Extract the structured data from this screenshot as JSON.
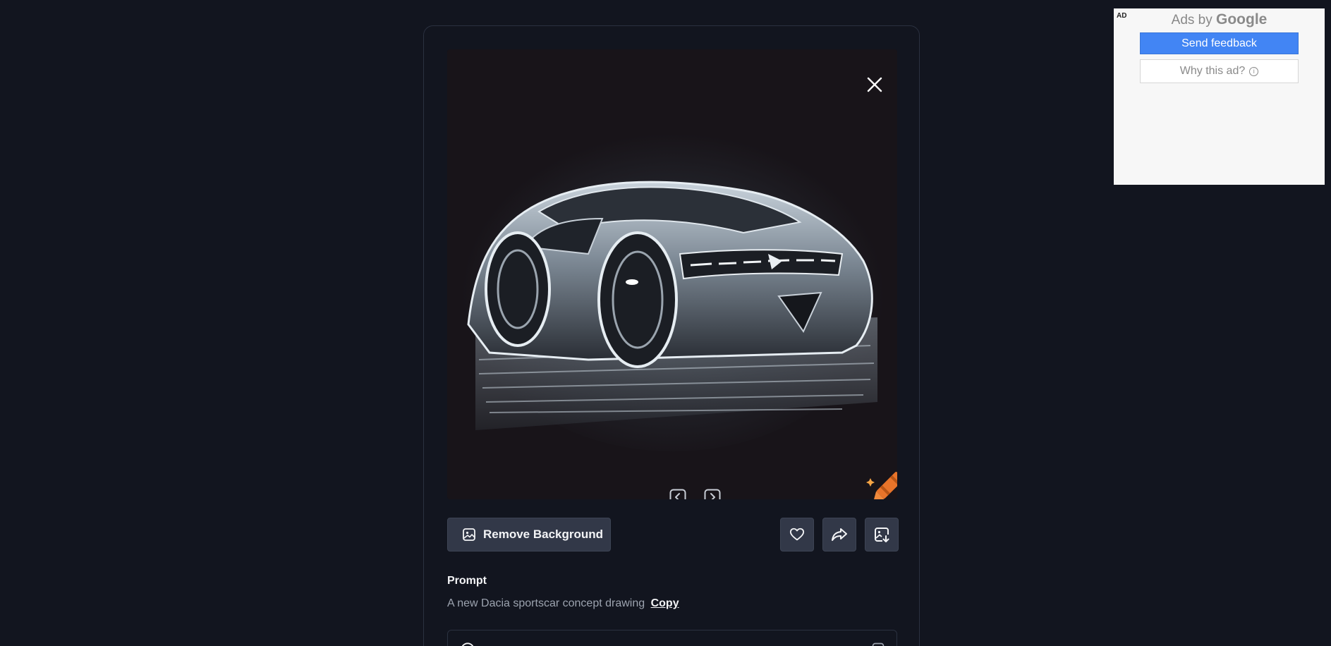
{
  "modal": {
    "image": {
      "alt_subject": "sportscar concept drawing",
      "close_icon": "close-icon",
      "prev_icon": "chevron-left-icon",
      "next_icon": "chevron-right-icon",
      "logo_icon": "crayon-logo-icon"
    },
    "actions": {
      "remove_background_label": "Remove Background",
      "remove_background_icon": "image-icon",
      "like_icon": "heart-icon",
      "share_icon": "share-icon",
      "save_icon": "save-image-icon"
    },
    "prompt": {
      "heading": "Prompt",
      "text": "A new Dacia sportscar concept drawing",
      "copy_label": "Copy"
    }
  },
  "ad": {
    "badge": "AD",
    "ads_by_prefix": "Ads by",
    "ads_by_brand": "Google",
    "send_feedback_label": "Send feedback",
    "why_this_ad_label": "Why this ad?"
  },
  "colors": {
    "background": "#12151f",
    "button_bg": "#323848",
    "accent_orange": "#e8742a",
    "ad_button_blue": "#4285f4"
  }
}
